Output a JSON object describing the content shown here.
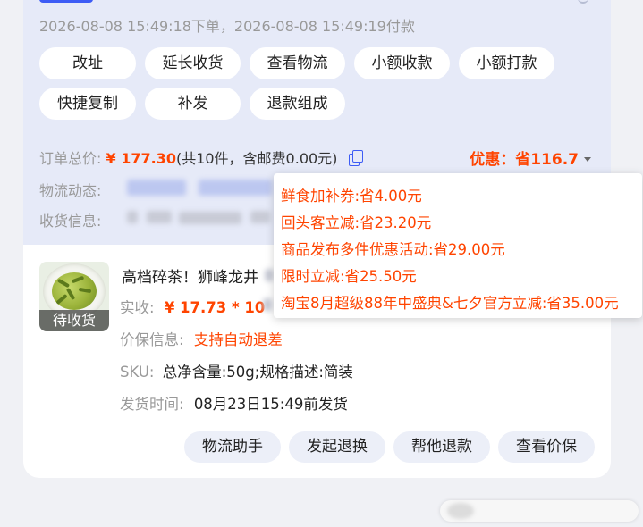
{
  "order": {
    "timestamps": "2026-08-08 15:49:18下单，2026-08-08 15:49:19付款",
    "actions_row1": [
      "改址",
      "延长收货",
      "查看物流",
      "小额收款",
      "小额打款"
    ],
    "actions_row2": [
      "快捷复制",
      "补发",
      "退款组成"
    ],
    "total_label": "订单总价:",
    "total_price": "¥ 177.30",
    "total_detail": "(共10件，含邮费0.00元)",
    "discount": "优惠：省116.7",
    "logistics_label": "物流动态:",
    "receiver_label": "收货信息:"
  },
  "discount_popover": {
    "items": [
      "鲜食加补券:省4.00元",
      "回头客立减:省23.20元",
      "商品发布多件优惠活动:省29.00元",
      "限时立减:省25.50元",
      "淘宝8月超级88年中盛典&七夕官方立减:省35.00元"
    ]
  },
  "product": {
    "status_overlay": "待收货",
    "title": "高档碎茶！狮峰龙井",
    "paid_label": "实收:",
    "paid_value": "¥ 17.73 * 10",
    "protection_label": "价保信息:",
    "protection_value": "支持自动退差",
    "sku_label": "SKU:",
    "sku_value": "总净含量:50g;规格描述:简装",
    "ship_label": "发货时间:",
    "ship_value": "08月23日15:49前发货",
    "actions": [
      "物流助手",
      "发起退换",
      "帮他退款",
      "查看价保"
    ]
  },
  "colors": {
    "accent": "#3d5cf5",
    "price": "#ff4400",
    "top_bg": "#e6eaf8"
  }
}
